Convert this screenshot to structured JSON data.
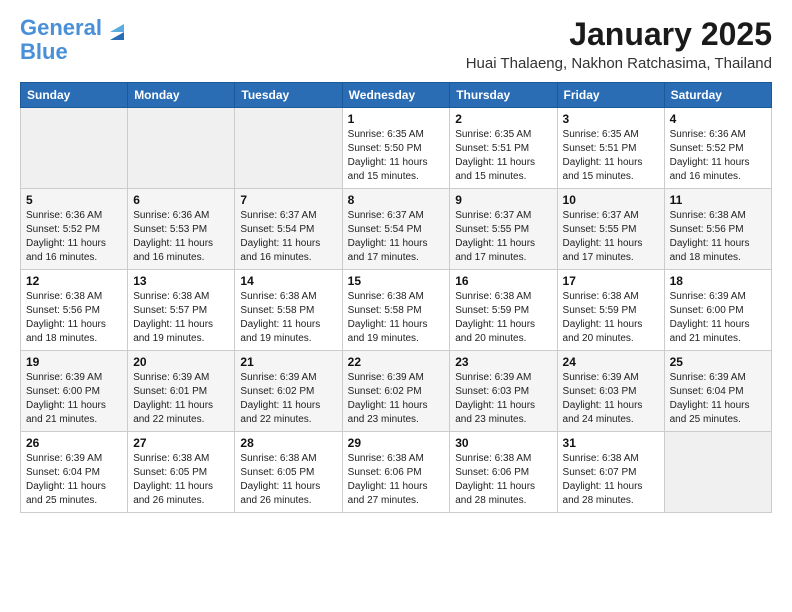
{
  "logo": {
    "part1": "General",
    "part2": "Blue"
  },
  "header": {
    "month_year": "January 2025",
    "location": "Huai Thalaeng, Nakhon Ratchasima, Thailand"
  },
  "days_of_week": [
    "Sunday",
    "Monday",
    "Tuesday",
    "Wednesday",
    "Thursday",
    "Friday",
    "Saturday"
  ],
  "weeks": [
    [
      {
        "day": "",
        "info": ""
      },
      {
        "day": "",
        "info": ""
      },
      {
        "day": "",
        "info": ""
      },
      {
        "day": "1",
        "info": "Sunrise: 6:35 AM\nSunset: 5:50 PM\nDaylight: 11 hours and 15 minutes."
      },
      {
        "day": "2",
        "info": "Sunrise: 6:35 AM\nSunset: 5:51 PM\nDaylight: 11 hours and 15 minutes."
      },
      {
        "day": "3",
        "info": "Sunrise: 6:35 AM\nSunset: 5:51 PM\nDaylight: 11 hours and 15 minutes."
      },
      {
        "day": "4",
        "info": "Sunrise: 6:36 AM\nSunset: 5:52 PM\nDaylight: 11 hours and 16 minutes."
      }
    ],
    [
      {
        "day": "5",
        "info": "Sunrise: 6:36 AM\nSunset: 5:52 PM\nDaylight: 11 hours and 16 minutes."
      },
      {
        "day": "6",
        "info": "Sunrise: 6:36 AM\nSunset: 5:53 PM\nDaylight: 11 hours and 16 minutes."
      },
      {
        "day": "7",
        "info": "Sunrise: 6:37 AM\nSunset: 5:54 PM\nDaylight: 11 hours and 16 minutes."
      },
      {
        "day": "8",
        "info": "Sunrise: 6:37 AM\nSunset: 5:54 PM\nDaylight: 11 hours and 17 minutes."
      },
      {
        "day": "9",
        "info": "Sunrise: 6:37 AM\nSunset: 5:55 PM\nDaylight: 11 hours and 17 minutes."
      },
      {
        "day": "10",
        "info": "Sunrise: 6:37 AM\nSunset: 5:55 PM\nDaylight: 11 hours and 17 minutes."
      },
      {
        "day": "11",
        "info": "Sunrise: 6:38 AM\nSunset: 5:56 PM\nDaylight: 11 hours and 18 minutes."
      }
    ],
    [
      {
        "day": "12",
        "info": "Sunrise: 6:38 AM\nSunset: 5:56 PM\nDaylight: 11 hours and 18 minutes."
      },
      {
        "day": "13",
        "info": "Sunrise: 6:38 AM\nSunset: 5:57 PM\nDaylight: 11 hours and 19 minutes."
      },
      {
        "day": "14",
        "info": "Sunrise: 6:38 AM\nSunset: 5:58 PM\nDaylight: 11 hours and 19 minutes."
      },
      {
        "day": "15",
        "info": "Sunrise: 6:38 AM\nSunset: 5:58 PM\nDaylight: 11 hours and 19 minutes."
      },
      {
        "day": "16",
        "info": "Sunrise: 6:38 AM\nSunset: 5:59 PM\nDaylight: 11 hours and 20 minutes."
      },
      {
        "day": "17",
        "info": "Sunrise: 6:38 AM\nSunset: 5:59 PM\nDaylight: 11 hours and 20 minutes."
      },
      {
        "day": "18",
        "info": "Sunrise: 6:39 AM\nSunset: 6:00 PM\nDaylight: 11 hours and 21 minutes."
      }
    ],
    [
      {
        "day": "19",
        "info": "Sunrise: 6:39 AM\nSunset: 6:00 PM\nDaylight: 11 hours and 21 minutes."
      },
      {
        "day": "20",
        "info": "Sunrise: 6:39 AM\nSunset: 6:01 PM\nDaylight: 11 hours and 22 minutes."
      },
      {
        "day": "21",
        "info": "Sunrise: 6:39 AM\nSunset: 6:02 PM\nDaylight: 11 hours and 22 minutes."
      },
      {
        "day": "22",
        "info": "Sunrise: 6:39 AM\nSunset: 6:02 PM\nDaylight: 11 hours and 23 minutes."
      },
      {
        "day": "23",
        "info": "Sunrise: 6:39 AM\nSunset: 6:03 PM\nDaylight: 11 hours and 23 minutes."
      },
      {
        "day": "24",
        "info": "Sunrise: 6:39 AM\nSunset: 6:03 PM\nDaylight: 11 hours and 24 minutes."
      },
      {
        "day": "25",
        "info": "Sunrise: 6:39 AM\nSunset: 6:04 PM\nDaylight: 11 hours and 25 minutes."
      }
    ],
    [
      {
        "day": "26",
        "info": "Sunrise: 6:39 AM\nSunset: 6:04 PM\nDaylight: 11 hours and 25 minutes."
      },
      {
        "day": "27",
        "info": "Sunrise: 6:38 AM\nSunset: 6:05 PM\nDaylight: 11 hours and 26 minutes."
      },
      {
        "day": "28",
        "info": "Sunrise: 6:38 AM\nSunset: 6:05 PM\nDaylight: 11 hours and 26 minutes."
      },
      {
        "day": "29",
        "info": "Sunrise: 6:38 AM\nSunset: 6:06 PM\nDaylight: 11 hours and 27 minutes."
      },
      {
        "day": "30",
        "info": "Sunrise: 6:38 AM\nSunset: 6:06 PM\nDaylight: 11 hours and 28 minutes."
      },
      {
        "day": "31",
        "info": "Sunrise: 6:38 AM\nSunset: 6:07 PM\nDaylight: 11 hours and 28 minutes."
      },
      {
        "day": "",
        "info": ""
      }
    ]
  ]
}
